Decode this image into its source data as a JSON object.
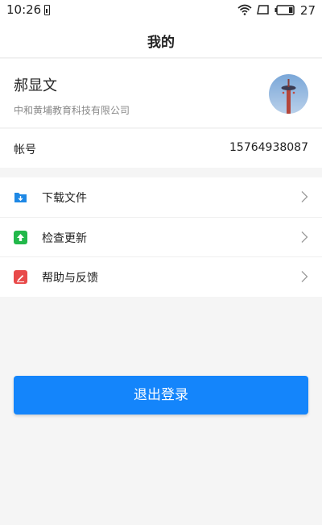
{
  "status_bar": {
    "time": "10:26",
    "battery_level": "27"
  },
  "header": {
    "title": "我的"
  },
  "profile": {
    "name": "郝显文",
    "company": "中和黄埔教育科技有限公司"
  },
  "account": {
    "label": "帐号",
    "value": "15764938087"
  },
  "menu": {
    "items": [
      {
        "label": "下载文件",
        "icon": "folder-download-icon",
        "color": "#1e88e5"
      },
      {
        "label": "检查更新",
        "icon": "upload-arrow-icon",
        "color": "#22b84a"
      },
      {
        "label": "帮助与反馈",
        "icon": "pencil-icon",
        "color": "#e84a4a"
      }
    ]
  },
  "logout_button": {
    "label": "退出登录",
    "color": "#1485fb"
  }
}
